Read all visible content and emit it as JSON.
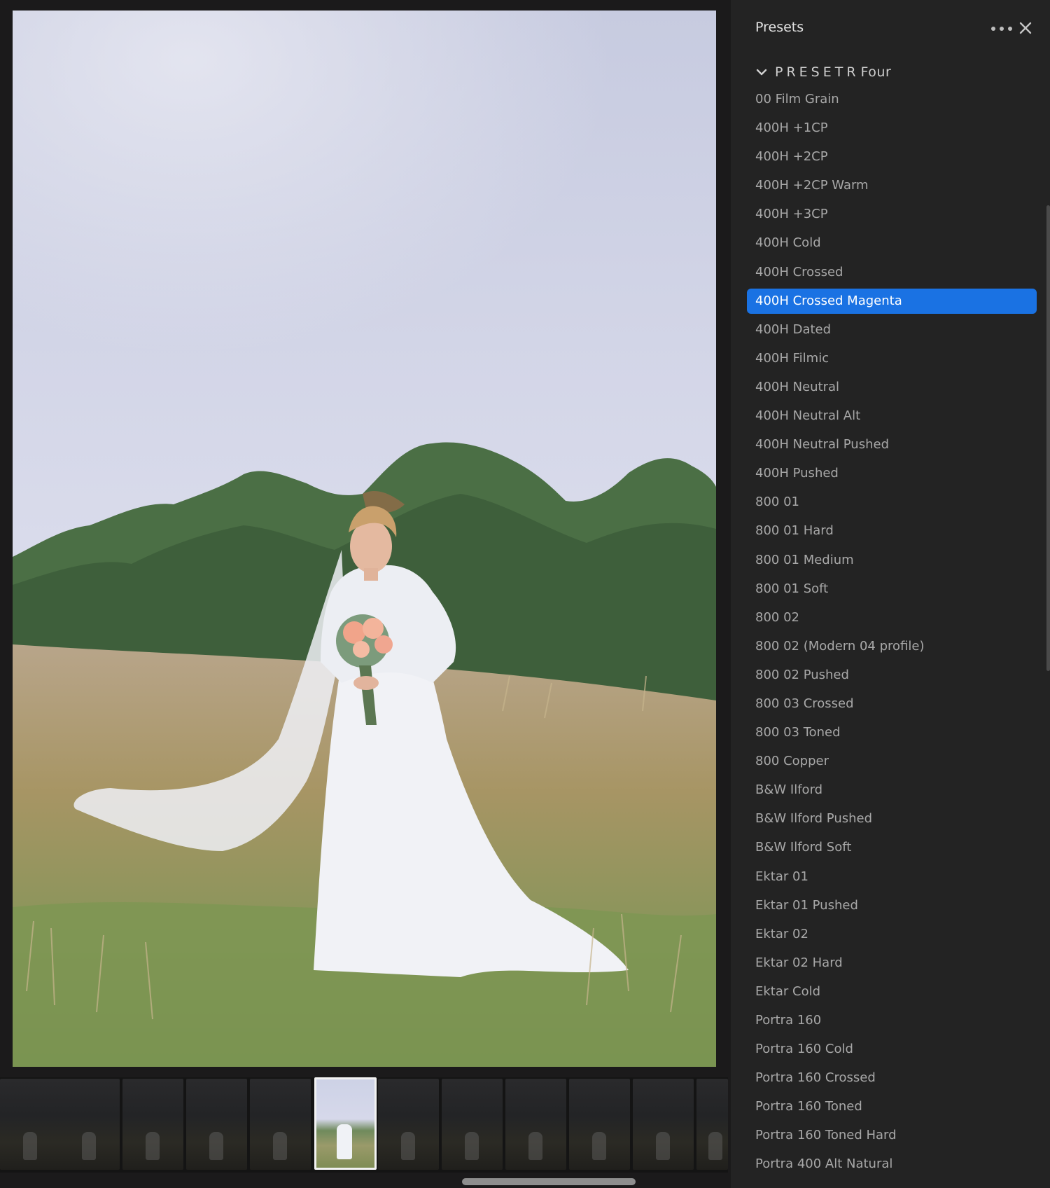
{
  "panel": {
    "title": "Presets",
    "more_icon": "more-horizontal-icon",
    "close_icon": "close-icon",
    "group": {
      "label": "PRESETR",
      "label_tail": "Four",
      "expanded": true
    },
    "selected_color": "#1a72e3",
    "items": [
      {
        "label": "00 Film Grain"
      },
      {
        "label": "400H +1CP"
      },
      {
        "label": "400H +2CP"
      },
      {
        "label": "400H +2CP Warm"
      },
      {
        "label": "400H +3CP"
      },
      {
        "label": "400H Cold"
      },
      {
        "label": "400H Crossed"
      },
      {
        "label": "400H Crossed Magenta",
        "selected": true
      },
      {
        "label": "400H Dated"
      },
      {
        "label": "400H Filmic"
      },
      {
        "label": "400H Neutral"
      },
      {
        "label": "400H Neutral Alt"
      },
      {
        "label": "400H Neutral Pushed"
      },
      {
        "label": "400H Pushed"
      },
      {
        "label": "800 01"
      },
      {
        "label": "800 01 Hard"
      },
      {
        "label": "800 01 Medium"
      },
      {
        "label": "800 01 Soft"
      },
      {
        "label": "800 02"
      },
      {
        "label": "800 02 (Modern 04 profile)"
      },
      {
        "label": "800 02 Pushed"
      },
      {
        "label": "800 03 Crossed"
      },
      {
        "label": "800 03 Toned"
      },
      {
        "label": "800 Copper"
      },
      {
        "label": "B&W Ilford"
      },
      {
        "label": "B&W Ilford Pushed"
      },
      {
        "label": "B&W Ilford Soft"
      },
      {
        "label": "Ektar 01"
      },
      {
        "label": "Ektar 01 Pushed"
      },
      {
        "label": "Ektar 02"
      },
      {
        "label": "Ektar 02 Hard"
      },
      {
        "label": "Ektar Cold"
      },
      {
        "label": "Portra 160"
      },
      {
        "label": "Portra 160 Cold"
      },
      {
        "label": "Portra 160 Crossed"
      },
      {
        "label": "Portra 160 Toned"
      },
      {
        "label": "Portra 160 Toned Hard"
      },
      {
        "label": "Portra 400 Alt Natural"
      }
    ]
  },
  "filmstrip": {
    "thumbnail_count": 12,
    "selected_index": 5
  }
}
